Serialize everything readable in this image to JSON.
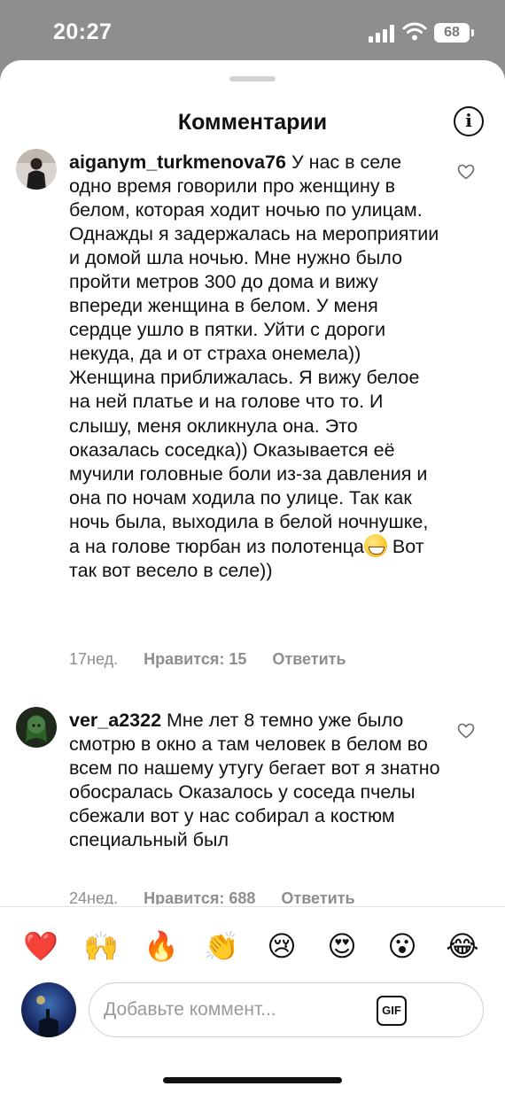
{
  "status_bar": {
    "time": "20:27",
    "battery": "68"
  },
  "header": {
    "title": "Комментарии",
    "info_icon": "info-icon"
  },
  "comments": [
    {
      "username": "aiganym_turkmenova76",
      "text": "У нас в селе одно время говорили про женщину в белом, которая ходит ночью по улицам. Однажды я задержалась на мероприятии и домой шла ночью. Мне нужно было пройти метров 300 до дома и вижу впереди женщина в белом. У меня сердце ушло в пятки. Уйти с дороги некуда, да и от страха онемела)) Женщина приближалась. Я вижу белое на ней платье и на голове что то. И слышу, меня окликнула она. Это оказалась соседка)) Оказывается её мучили головные боли из-за давления и она по ночам ходила по улице. Так как ночь была, выходила в белой ночнушке, а на голове тюрбан из полотенца",
      "emoji": "grinning-face-emoji",
      "text_end": " Вот так вот весело в селе))",
      "age": "17нед.",
      "likes": "Нравится: 15",
      "reply": "Ответить"
    },
    {
      "username": "ver_a2322",
      "text": "Мне лет 8 темно уже было смотрю в окно а там человек в белом во всем по нашему утугу бегает вот я знатно обосралась Оказалось у соседа пчелы сбежали вот у нас собирал а костюм специальный был",
      "age": "24нед.",
      "likes": "Нравится: 688",
      "reply": "Ответить"
    }
  ],
  "reactions": [
    {
      "name": "red-heart",
      "glyph": "❤️"
    },
    {
      "name": "raising-hands",
      "glyph": "🙌"
    },
    {
      "name": "fire",
      "glyph": "🔥"
    },
    {
      "name": "clapping-hands",
      "glyph": "👏"
    },
    {
      "name": "crying-face",
      "glyph": "😢"
    },
    {
      "name": "heart-eyes",
      "glyph": "😍"
    },
    {
      "name": "astonished-face",
      "glyph": "😮"
    },
    {
      "name": "tears-of-joy",
      "glyph": "😂"
    }
  ],
  "composer": {
    "placeholder": "Добавьте коммент...",
    "gif_label": "GIF"
  },
  "colors": {
    "background": "#ffffff",
    "secondary_text": "#8e8e8e",
    "status_bg": "#8e8e8e"
  }
}
